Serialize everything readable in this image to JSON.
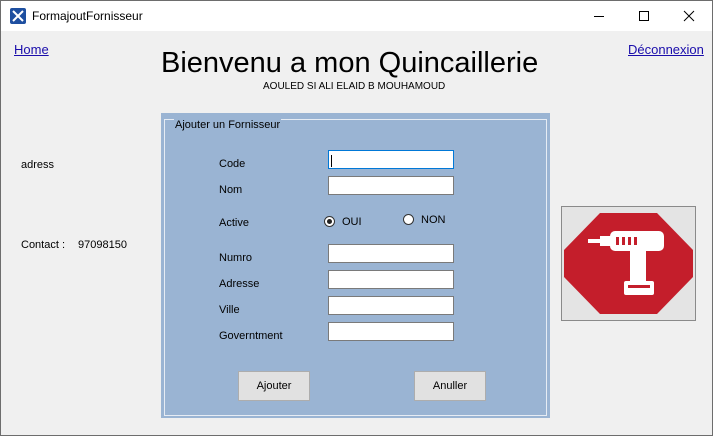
{
  "window": {
    "title": "FormajoutFornisseur"
  },
  "nav": {
    "home": "Home",
    "logout": "Déconnexion"
  },
  "header": {
    "title": "Bienvenu a mon Quincaillerie",
    "subtitle": "AOULED SI ALI ELAID B MOUHAMOUD"
  },
  "info": {
    "adress_label": "adress",
    "contact_label": "Contact :",
    "contact_value": "97098150"
  },
  "form": {
    "legend": "Ajouter un Fornisseur",
    "labels": {
      "code": "Code",
      "nom": "Nom",
      "active": "Active",
      "numro": "Numro",
      "adresse": "Adresse",
      "ville": "Ville",
      "government": "Governtment"
    },
    "values": {
      "code": "",
      "nom": "",
      "numro": "",
      "adresse": "",
      "ville": "",
      "government": ""
    },
    "active_options": [
      {
        "label": "OUI",
        "selected": true
      },
      {
        "label": "NON",
        "selected": false
      }
    ],
    "buttons": {
      "ajouter": "Ajouter",
      "annuler": "Anuller"
    }
  },
  "colors": {
    "panel": "#9ab4d3",
    "logo_red": "#c41e2b",
    "link": "#1a0dab"
  },
  "icons": {
    "app": "app-icon",
    "logo": "drill-stop-icon"
  }
}
